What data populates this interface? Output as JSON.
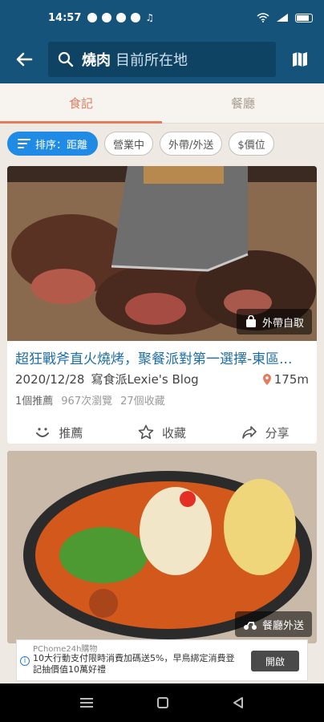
{
  "status_bar": {
    "time": "14:57"
  },
  "search": {
    "keyword": "燒肉",
    "location": "目前所在地"
  },
  "tabs": [
    {
      "label": "食記"
    },
    {
      "label": "餐廳"
    }
  ],
  "filters": {
    "sort": "排序：距離",
    "chips": [
      "營業中",
      "外帶/外送",
      "$價位"
    ]
  },
  "cards": [
    {
      "badge": "外帶自取",
      "title": "超狂戰斧直火燒烤，聚餐派對第一選擇-東區...",
      "date": "2020/12/28",
      "blog": "寫食派Lexie's Blog",
      "distance": "175m",
      "recommend_count": "1個推薦",
      "views": "967次瀏覽",
      "favorites": "27個收藏",
      "actions": {
        "recommend": "推薦",
        "favorite": "收藏",
        "share": "分享"
      }
    },
    {
      "badge": "餐廳外送"
    }
  ],
  "ad": {
    "source": "PChome24h購物",
    "text": "10大行動支付限時消費加碼送5%，早鳥綁定消費登記抽價值10萬好禮",
    "button": "開啟",
    "info_icon": "i"
  },
  "colors": {
    "header": "#15537a",
    "accent": "#e27d60",
    "primary": "#1f8be4"
  }
}
